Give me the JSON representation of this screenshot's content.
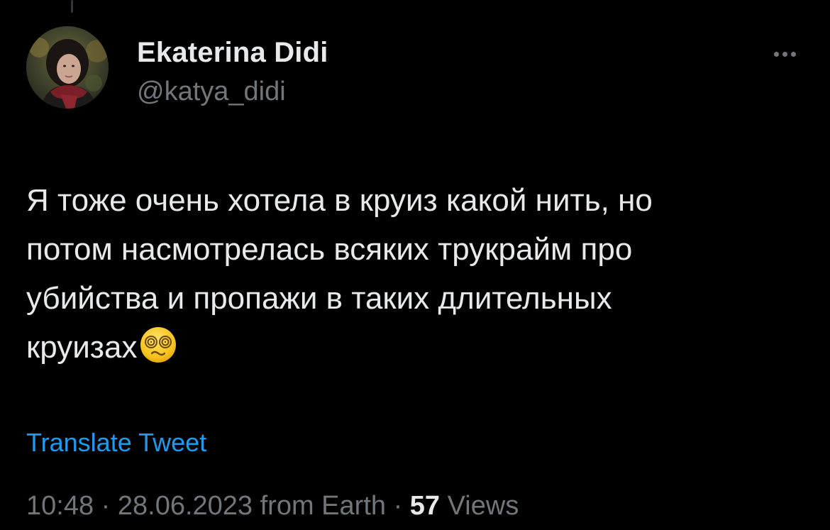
{
  "colors": {
    "background": "#000000",
    "primary_text": "#e7e9ea",
    "secondary_text": "#71767b",
    "link": "#1d9bf0"
  },
  "author": {
    "display_name": "Ekaterina Didi",
    "handle": "@katya_didi",
    "avatar_icon": "profile-photo"
  },
  "more_icon": "ellipsis-icon",
  "tweet": {
    "lines": [
      "Я тоже очень хотела в круиз какой нить, но",
      "потом насмотрелась всяких трукрайм про",
      "убийства и пропажи в таких длительных",
      "круизах"
    ],
    "emoji": "dizzy-face-emoji"
  },
  "translate_label": "Translate Tweet",
  "meta": {
    "time": "10:48",
    "separator": " · ",
    "date": "28.06.2023",
    "source": "from Earth",
    "views_count": "57",
    "views_label": "Views"
  }
}
